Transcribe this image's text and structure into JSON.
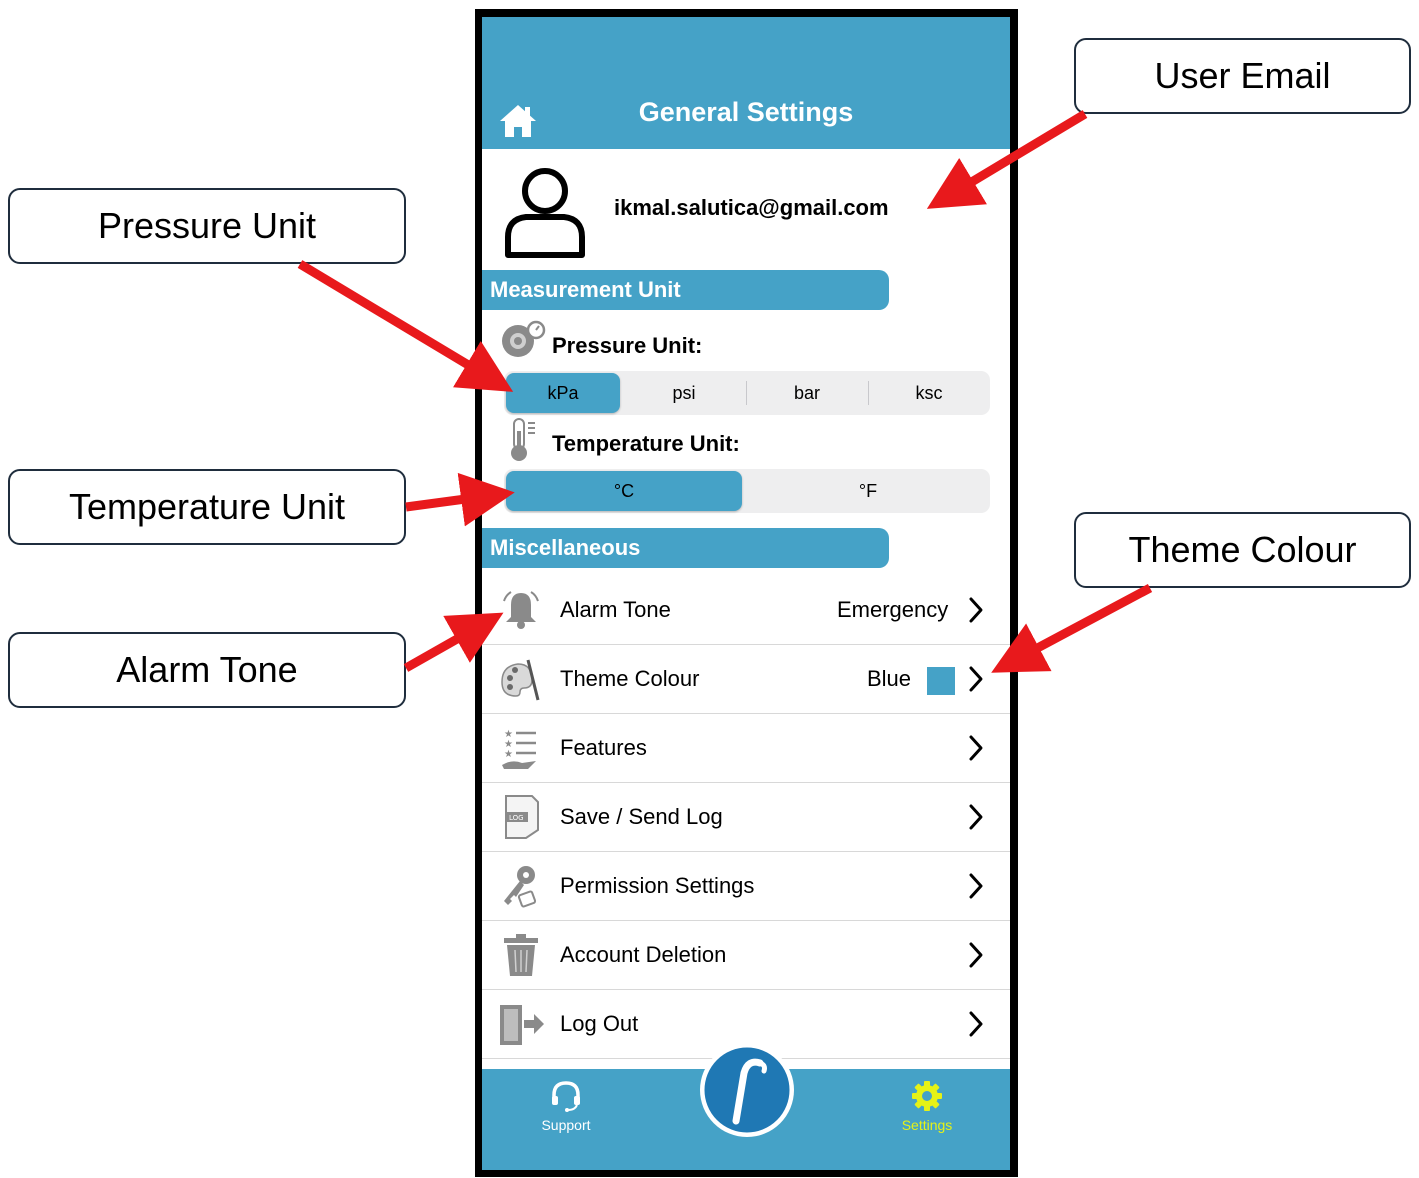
{
  "callouts": {
    "user_email": "User Email",
    "pressure_unit": "Pressure Unit",
    "temperature_unit": "Temperature Unit",
    "theme_colour": "Theme Colour",
    "alarm_tone": "Alarm Tone"
  },
  "colors": {
    "accent": "#45a2c7",
    "arrow": "#e8191c",
    "active_tab": "#e6f216"
  },
  "header": {
    "title": "General Settings",
    "home_icon": "home-icon"
  },
  "profile": {
    "email": "ikmal.salutica@gmail.com",
    "avatar_icon": "user-outline-icon"
  },
  "measurement": {
    "section_title": "Measurement Unit",
    "pressure": {
      "label": "Pressure Unit:",
      "options": [
        "kPa",
        "psi",
        "bar",
        "ksc"
      ],
      "selected": "kPa"
    },
    "temperature": {
      "label": "Temperature Unit:",
      "options": [
        "°C",
        "°F"
      ],
      "selected": "°C"
    }
  },
  "misc": {
    "section_title": "Miscellaneous",
    "items": [
      {
        "label": "Alarm Tone",
        "value": "Emergency",
        "icon": "bell-icon"
      },
      {
        "label": "Theme Colour",
        "value": "Blue",
        "icon": "palette-icon"
      },
      {
        "label": "Features",
        "icon": "feature-list-icon"
      },
      {
        "label": "Save / Send Log",
        "icon": "log-file-icon"
      },
      {
        "label": "Permission Settings",
        "icon": "key-icon"
      },
      {
        "label": "Account Deletion",
        "icon": "trash-icon"
      },
      {
        "label": "Log Out",
        "icon": "logout-door-icon"
      }
    ]
  },
  "tabbar": {
    "support": "Support",
    "settings": "Settings",
    "center_logo": "f-logo-icon",
    "active": "settings"
  }
}
